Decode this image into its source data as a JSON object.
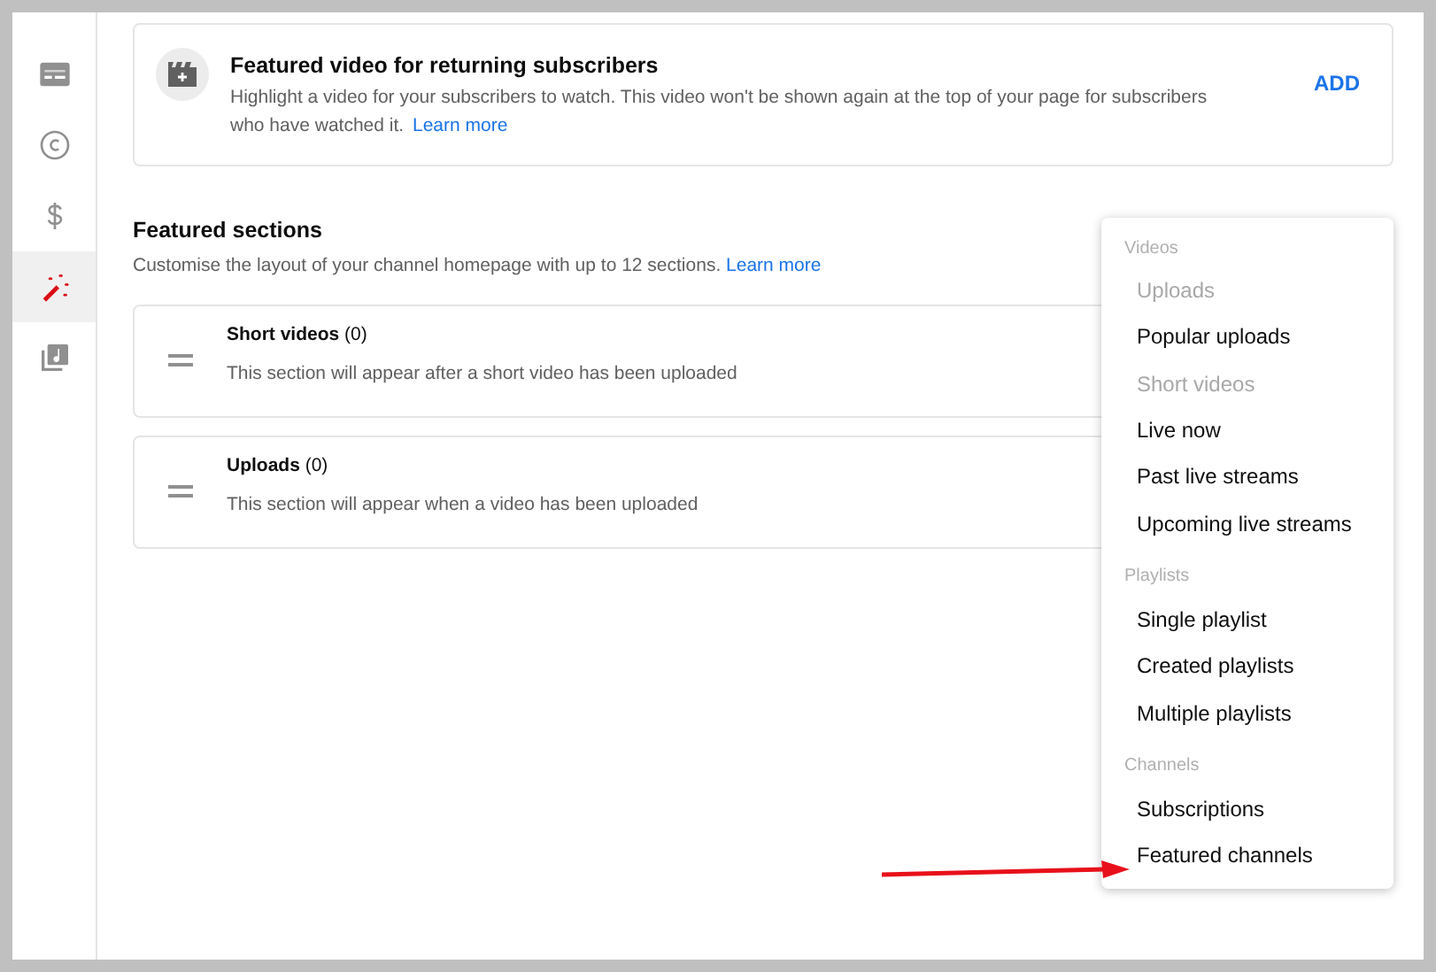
{
  "sidebar": {
    "items": [
      {
        "kind": "subtitles",
        "selected": false
      },
      {
        "kind": "copyright",
        "selected": false
      },
      {
        "kind": "dollar",
        "selected": false
      },
      {
        "kind": "wand",
        "selected": true
      },
      {
        "kind": "library",
        "selected": false
      }
    ]
  },
  "featured_video": {
    "title": "Featured video for returning subscribers",
    "description": "Highlight a video for your subscribers to watch. This video won't be shown again at the top of your page for subscribers who have watched it.",
    "link": "Learn more",
    "action": "ADD"
  },
  "featured_sections": {
    "title": "Featured sections",
    "description": "Customise the layout of your channel homepage with up to 12 sections.",
    "link": "Learn more",
    "sections": [
      {
        "title": "**Short videos** (0)",
        "description": "This section will appear after a short video has been uploaded"
      },
      {
        "title": "**Uploads** (0)",
        "description": "This section will appear when a video has been uploaded"
      }
    ]
  },
  "menu": {
    "groups": [
      {
        "heading": "Videos",
        "items": [
          {
            "label": "Uploads",
            "disabled": true
          },
          {
            "label": "Popular uploads",
            "disabled": false
          },
          {
            "label": "Short videos",
            "disabled": true
          },
          {
            "label": "Live now",
            "disabled": false
          },
          {
            "label": "Past live streams",
            "disabled": false
          },
          {
            "label": "Upcoming live streams",
            "disabled": false
          }
        ]
      },
      {
        "heading": "Playlists",
        "items": [
          {
            "label": "Single playlist",
            "disabled": false
          },
          {
            "label": "Created playlists",
            "disabled": false
          },
          {
            "label": "Multiple playlists",
            "disabled": false
          }
        ]
      },
      {
        "heading": "Channels",
        "items": [
          {
            "label": "Subscriptions",
            "disabled": false
          },
          {
            "label": "Featured channels",
            "disabled": false
          }
        ]
      }
    ]
  }
}
